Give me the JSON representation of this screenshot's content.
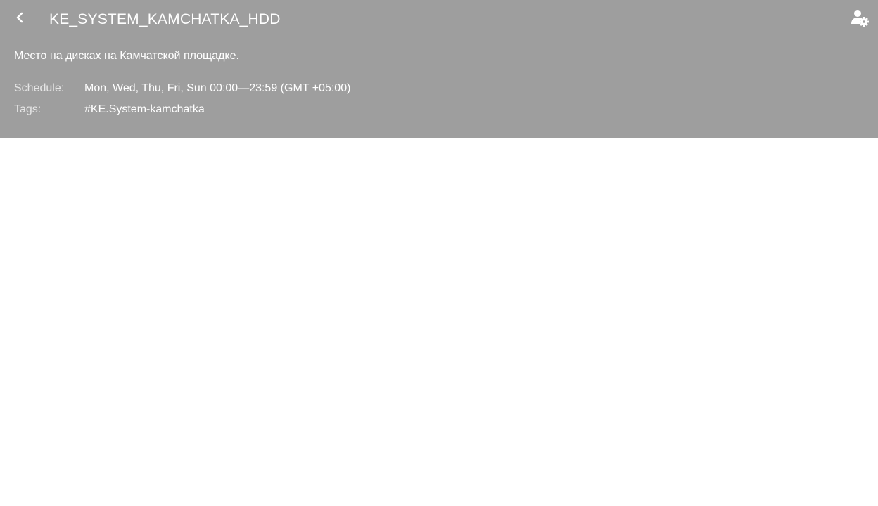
{
  "header": {
    "title": "KE_SYSTEM_KAMCHATKA_HDD",
    "description": "Место на дисках на Камчатской площадке.",
    "back_icon": "chevron-left-icon",
    "settings_icon": "user-settings-icon"
  },
  "meta": {
    "schedule_label": "Schedule:",
    "schedule_value": "Mon, Wed, Thu, Fri, Sun 00:00—23:59 (GMT +05:00)",
    "tags_label": "Tags:",
    "tags_value": "#KE.System-kamchatka"
  },
  "colors": {
    "header_bg": "#9e9e9e",
    "text": "#ffffff",
    "page_bg": "#ffffff"
  }
}
